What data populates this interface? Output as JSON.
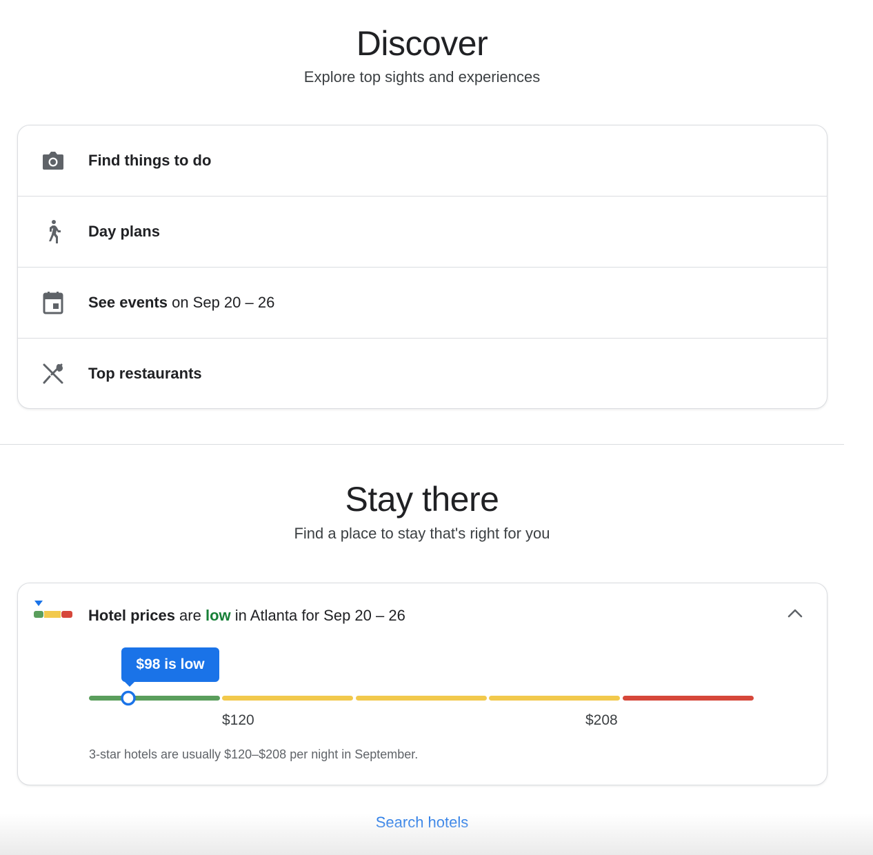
{
  "discover": {
    "title": "Discover",
    "subtitle": "Explore top sights and experiences",
    "items": [
      {
        "icon": "camera-icon",
        "label_bold": "Find things to do",
        "label_rest": ""
      },
      {
        "icon": "walking-person-icon",
        "label_bold": "Day plans",
        "label_rest": ""
      },
      {
        "icon": "calendar-event-icon",
        "label_bold": "See events",
        "label_rest": " on Sep 20 – 26"
      },
      {
        "icon": "fork-knife-icon",
        "label_bold": "Top restaurants",
        "label_rest": ""
      }
    ]
  },
  "stay": {
    "title": "Stay there",
    "subtitle": "Find a place to stay that's right for you",
    "hotel_card": {
      "icon": "price-level-icon",
      "header_bold": "Hotel prices",
      "header_are": " are ",
      "header_level": "low",
      "header_rest": " in Atlanta for Sep 20 – 26",
      "tooltip": "$98 is low",
      "current_price": 98,
      "typical_low_label": "$120",
      "typical_high_label": "$208",
      "typical_low": 120,
      "typical_high": 208,
      "note": "3-star hotels are usually $120–$208 per night in September.",
      "colors": {
        "low": "#5a9e5c",
        "typical": "#f2c94c",
        "high": "#d6473a",
        "marker": "#1a73e8"
      }
    },
    "search_link": "Search hotels"
  }
}
